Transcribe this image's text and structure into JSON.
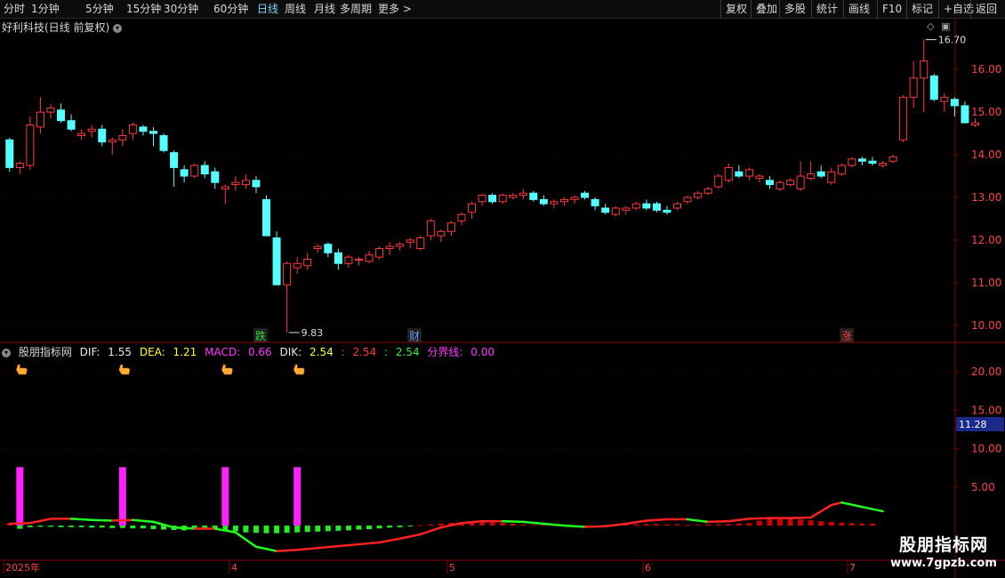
{
  "toolbar": {
    "periods": [
      "分时",
      "1分钟",
      "5分钟",
      "15分钟",
      "30分钟",
      "60分钟",
      "日线",
      "周线",
      "月线",
      "多周期",
      "更多 >"
    ],
    "active_period": "日线",
    "right_buttons": [
      "复权",
      "叠加",
      "多股",
      "统计",
      "画线",
      "F10",
      "标记",
      "+自选",
      "返回"
    ]
  },
  "main_chart": {
    "title": "好利科技(日线 前复权)",
    "y_ticks": [
      "16.00",
      "15.00",
      "14.00",
      "13.00",
      "12.00",
      "11.00",
      "10.00"
    ],
    "high_label": "16.70",
    "low_label": "9.83",
    "markers": [
      {
        "text": "跌",
        "color": "#33dd33"
      },
      {
        "text": "财",
        "color": "#6699ff"
      },
      {
        "text": "涨",
        "color": "#ff4444"
      }
    ]
  },
  "indicator": {
    "name": "股朋指标网",
    "dif_label": "DIF:",
    "dif_value": "1.55",
    "dea_label": "DEA:",
    "dea_value": "1.21",
    "macd_label": "MACD:",
    "macd_value": "0.66",
    "dik_label": "DIK:",
    "dik_value": "2.54",
    "red_label": ":",
    "red_value": "2.54",
    "green_label": ":",
    "green_value": "2.54",
    "line_label": "分界线:",
    "line_value": "0.00",
    "y_ticks": [
      "20.00",
      "15.00",
      "10.00",
      "5.00"
    ],
    "current_value": "11.28"
  },
  "x_axis": {
    "labels": [
      "2025年",
      "4",
      "5",
      "6",
      "7"
    ]
  },
  "watermark": {
    "title": "股朋指标网",
    "url": "www.7gpzb.com"
  },
  "colors": {
    "up": "#ff3b3b",
    "down": "#54ffff",
    "macd_up": "#cc0000",
    "macd_down": "#22ee22",
    "magenta": "#ff22ff",
    "grid": "#3a0000"
  },
  "chart_data": {
    "type": "candlestick",
    "y_range": [
      9.6,
      16.9
    ],
    "ohlc": [
      [
        14.35,
        14.4,
        13.6,
        13.7
      ],
      [
        13.7,
        13.85,
        13.55,
        13.8
      ],
      [
        13.75,
        14.9,
        13.65,
        14.7
      ],
      [
        14.65,
        15.35,
        14.5,
        15.0
      ],
      [
        15.0,
        15.2,
        14.85,
        15.1
      ],
      [
        15.05,
        15.2,
        14.75,
        14.8
      ],
      [
        14.8,
        14.95,
        14.55,
        14.6
      ],
      [
        14.45,
        14.6,
        14.35,
        14.5
      ],
      [
        14.55,
        14.7,
        14.4,
        14.6
      ],
      [
        14.6,
        14.7,
        14.2,
        14.3
      ],
      [
        14.3,
        14.4,
        14.0,
        14.35
      ],
      [
        14.35,
        14.6,
        14.2,
        14.45
      ],
      [
        14.5,
        14.75,
        14.35,
        14.7
      ],
      [
        14.65,
        14.7,
        14.45,
        14.55
      ],
      [
        14.55,
        14.65,
        14.2,
        14.5
      ],
      [
        14.45,
        14.5,
        14.05,
        14.1
      ],
      [
        14.05,
        14.1,
        13.25,
        13.7
      ],
      [
        13.65,
        13.75,
        13.35,
        13.5
      ],
      [
        13.5,
        13.8,
        13.45,
        13.75
      ],
      [
        13.75,
        13.85,
        13.45,
        13.55
      ],
      [
        13.6,
        13.7,
        13.2,
        13.35
      ],
      [
        13.2,
        13.3,
        12.85,
        13.25
      ],
      [
        13.3,
        13.5,
        13.15,
        13.35
      ],
      [
        13.3,
        13.55,
        13.2,
        13.4
      ],
      [
        13.4,
        13.5,
        13.1,
        13.25
      ],
      [
        12.95,
        13.05,
        12.15,
        12.1
      ],
      [
        12.05,
        12.2,
        10.95,
        10.95
      ],
      [
        10.95,
        11.5,
        9.83,
        11.45
      ],
      [
        11.35,
        11.6,
        11.2,
        11.45
      ],
      [
        11.4,
        11.7,
        11.3,
        11.55
      ],
      [
        11.8,
        11.9,
        11.7,
        11.85
      ],
      [
        11.9,
        11.95,
        11.6,
        11.7
      ],
      [
        11.7,
        11.8,
        11.3,
        11.45
      ],
      [
        11.45,
        11.65,
        11.35,
        11.6
      ],
      [
        11.55,
        11.6,
        11.4,
        11.55
      ],
      [
        11.5,
        11.75,
        11.45,
        11.65
      ],
      [
        11.6,
        11.85,
        11.55,
        11.8
      ],
      [
        11.8,
        11.95,
        11.65,
        11.85
      ],
      [
        11.85,
        11.95,
        11.75,
        11.9
      ],
      [
        11.95,
        12.05,
        11.8,
        12.0
      ],
      [
        11.8,
        12.1,
        11.75,
        12.05
      ],
      [
        12.1,
        12.5,
        12.0,
        12.45
      ],
      [
        12.1,
        12.25,
        11.95,
        12.2
      ],
      [
        12.2,
        12.45,
        12.1,
        12.4
      ],
      [
        12.45,
        12.65,
        12.35,
        12.6
      ],
      [
        12.65,
        12.9,
        12.5,
        12.85
      ],
      [
        12.9,
        13.1,
        12.8,
        13.05
      ],
      [
        13.05,
        13.1,
        12.85,
        12.9
      ],
      [
        12.9,
        13.1,
        12.85,
        13.05
      ],
      [
        13.0,
        13.1,
        12.95,
        13.05
      ],
      [
        13.05,
        13.2,
        12.95,
        13.1
      ],
      [
        13.1,
        13.15,
        12.9,
        12.95
      ],
      [
        12.95,
        13.05,
        12.8,
        12.85
      ],
      [
        12.85,
        12.95,
        12.75,
        12.9
      ],
      [
        12.9,
        13.0,
        12.8,
        12.95
      ],
      [
        12.95,
        13.05,
        12.85,
        13.0
      ],
      [
        13.1,
        13.15,
        12.95,
        13.0
      ],
      [
        12.95,
        13.0,
        12.7,
        12.8
      ],
      [
        12.75,
        12.85,
        12.6,
        12.65
      ],
      [
        12.6,
        12.8,
        12.55,
        12.75
      ],
      [
        12.7,
        12.8,
        12.6,
        12.75
      ],
      [
        12.75,
        12.9,
        12.7,
        12.85
      ],
      [
        12.85,
        12.95,
        12.7,
        12.75
      ],
      [
        12.85,
        12.9,
        12.65,
        12.7
      ],
      [
        12.7,
        12.8,
        12.6,
        12.65
      ],
      [
        12.75,
        12.9,
        12.7,
        12.85
      ],
      [
        12.9,
        13.05,
        12.85,
        13.0
      ],
      [
        13.0,
        13.15,
        12.95,
        13.1
      ],
      [
        13.1,
        13.25,
        13.05,
        13.2
      ],
      [
        13.25,
        13.55,
        13.2,
        13.5
      ],
      [
        13.4,
        13.8,
        13.35,
        13.7
      ],
      [
        13.6,
        13.75,
        13.45,
        13.5
      ],
      [
        13.5,
        13.7,
        13.4,
        13.65
      ],
      [
        13.45,
        13.55,
        13.35,
        13.5
      ],
      [
        13.4,
        13.5,
        13.2,
        13.3
      ],
      [
        13.2,
        13.4,
        13.15,
        13.35
      ],
      [
        13.3,
        13.45,
        13.25,
        13.4
      ],
      [
        13.2,
        13.85,
        13.15,
        13.5
      ],
      [
        13.45,
        13.85,
        13.4,
        13.55
      ],
      [
        13.6,
        13.75,
        13.45,
        13.5
      ],
      [
        13.35,
        13.7,
        13.3,
        13.6
      ],
      [
        13.55,
        13.8,
        13.5,
        13.75
      ],
      [
        13.75,
        13.95,
        13.7,
        13.9
      ],
      [
        13.9,
        13.95,
        13.75,
        13.85
      ],
      [
        13.85,
        13.95,
        13.75,
        13.8
      ],
      [
        13.75,
        13.85,
        13.7,
        13.8
      ],
      [
        13.85,
        14.0,
        13.8,
        13.95
      ],
      [
        14.35,
        15.4,
        14.3,
        15.35
      ],
      [
        15.35,
        16.2,
        15.1,
        15.8
      ],
      [
        15.8,
        16.7,
        15.0,
        16.2
      ],
      [
        15.85,
        15.9,
        15.25,
        15.3
      ],
      [
        15.25,
        15.45,
        15.0,
        15.35
      ],
      [
        15.3,
        15.35,
        14.9,
        15.15
      ],
      [
        15.15,
        15.25,
        14.75,
        14.75
      ],
      [
        14.7,
        14.85,
        14.65,
        14.75
      ]
    ],
    "indicator": {
      "dif_value": 1.55,
      "dea_value": 1.21,
      "macd_value": 0.66,
      "dik_value": 2.54,
      "boundary": 0.0,
      "y_ticks": [
        5,
        10,
        15,
        20
      ],
      "signal_bar_bars": [
        1,
        11,
        21,
        28
      ],
      "curve": [
        [
          0,
          0.3
        ],
        [
          2,
          0.4
        ],
        [
          4,
          1.1
        ],
        [
          6,
          1.1
        ],
        [
          8,
          0.9
        ],
        [
          10,
          0.8
        ],
        [
          12,
          0.9
        ],
        [
          14,
          0.6
        ],
        [
          16,
          -0.3
        ],
        [
          18,
          -0.5
        ],
        [
          20,
          -0.5
        ],
        [
          22,
          -1.1
        ],
        [
          24,
          -3.4
        ],
        [
          26,
          -4.1
        ],
        [
          28,
          -3.9
        ],
        [
          30,
          -3.6
        ],
        [
          32,
          -3.3
        ],
        [
          34,
          -3.0
        ],
        [
          36,
          -2.7
        ],
        [
          38,
          -2.1
        ],
        [
          40,
          -1.4
        ],
        [
          42,
          -0.3
        ],
        [
          44,
          0.4
        ],
        [
          46,
          0.7
        ],
        [
          48,
          0.7
        ],
        [
          50,
          0.6
        ],
        [
          52,
          0.3
        ],
        [
          54,
          0.0
        ],
        [
          56,
          -0.2
        ],
        [
          58,
          -0.1
        ],
        [
          60,
          0.3
        ],
        [
          62,
          0.8
        ],
        [
          64,
          1.0
        ],
        [
          66,
          1.0
        ],
        [
          68,
          0.6
        ],
        [
          70,
          0.7
        ],
        [
          72,
          1.1
        ],
        [
          74,
          1.2
        ],
        [
          76,
          1.2
        ],
        [
          78,
          1.3
        ],
        [
          80,
          3.3
        ],
        [
          81,
          3.7
        ],
        [
          83,
          3.0
        ],
        [
          85,
          2.3
        ]
      ],
      "histogram": [
        0.6,
        -0.8,
        -0.4,
        -0.3,
        -0.3,
        -0.4,
        -0.4,
        -0.4,
        -0.5,
        -0.5,
        -0.6,
        -0.6,
        -0.7,
        -0.7,
        -0.9,
        -1.0,
        -1.1,
        -1.2,
        -1.0,
        -1.0,
        -0.9,
        -1.2,
        -1.4,
        -1.7,
        -1.8,
        -1.9,
        -1.9,
        -1.8,
        -1.7,
        -1.6,
        -1.5,
        -1.4,
        -1.3,
        -1.2,
        -1.0,
        -0.9,
        -0.7,
        -0.5,
        -0.4,
        -0.2,
        0.1,
        0.3,
        0.5,
        0.7,
        0.8,
        0.9,
        0.9,
        0.8,
        0.7,
        0.5,
        0.3,
        0.2,
        0.2,
        0.1,
        0.0,
        -0.2,
        -0.2,
        -0.3,
        -0.2,
        0.1,
        0.2,
        0.3,
        0.4,
        0.4,
        0.3,
        0.3,
        0.2,
        0.2,
        0.3,
        0.3,
        0.4,
        0.5,
        0.6,
        1.2,
        1.6,
        1.9,
        1.8,
        1.5,
        1.3,
        1.1,
        0.9,
        0.7,
        0.6,
        0.5,
        0.5
      ]
    }
  }
}
